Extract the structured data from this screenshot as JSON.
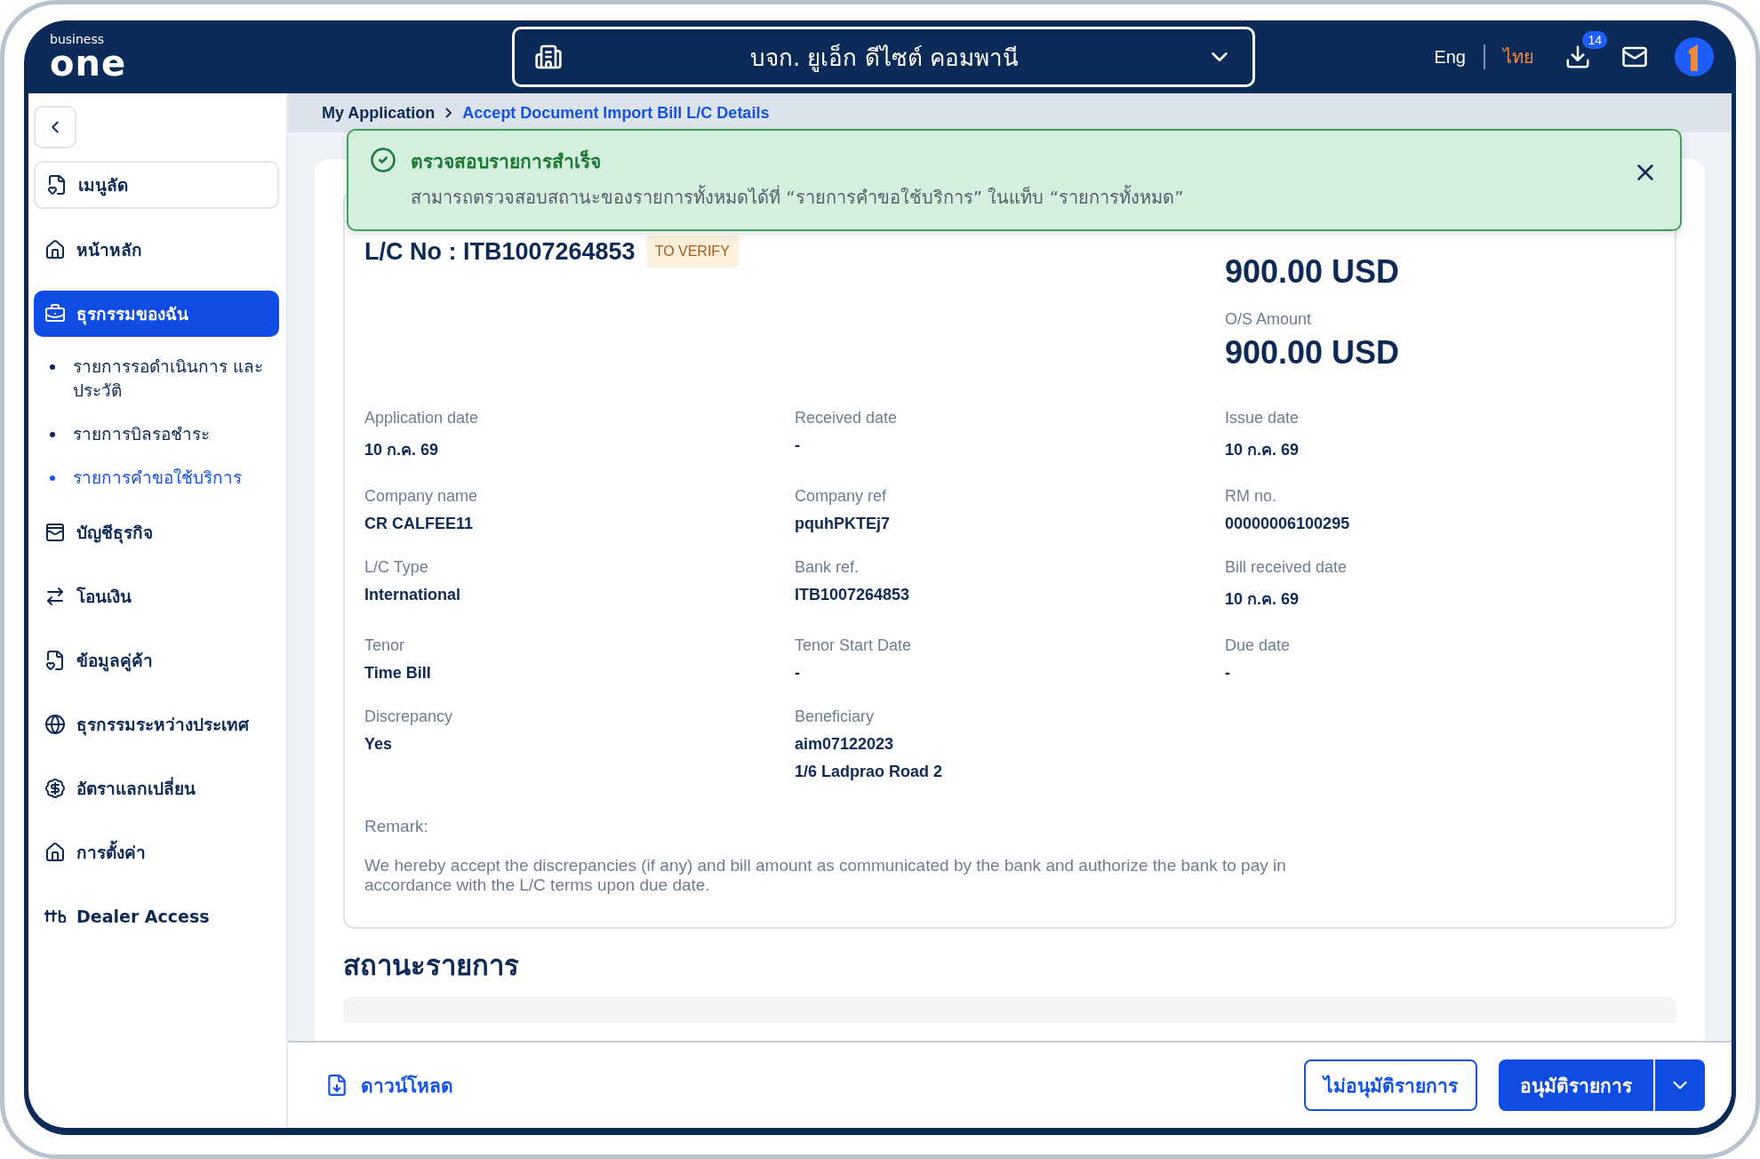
{
  "header": {
    "brand_small": "business",
    "brand": "one",
    "company": "บจก. ยูเอ็ก ดีไซต์ คอมพานี",
    "languages": [
      {
        "label": "Eng",
        "selected": false
      },
      {
        "label": "ไทย",
        "selected": true
      }
    ],
    "download_badge": "14"
  },
  "sidebar": {
    "items": [
      {
        "label": "เมนูลัด",
        "kind": "shortcut",
        "selected": false
      },
      {
        "label": "หน้าหลัก",
        "kind": "item",
        "selected": false
      },
      {
        "label": "ธุรกรรมของฉัน",
        "kind": "item",
        "selected": true,
        "children": [
          {
            "label": "รายการรอดำเนินการ และประวัติ",
            "selected": false
          },
          {
            "label": "รายการบิลรอชำระ",
            "selected": false
          },
          {
            "label": "รายการคำขอใช้บริการ",
            "selected": true
          }
        ]
      },
      {
        "label": "บัญชีธุรกิจ",
        "kind": "item",
        "selected": false
      },
      {
        "label": "โอนเงิน",
        "kind": "item",
        "selected": false
      },
      {
        "label": "ข้อมูลคู่ค้า",
        "kind": "item",
        "selected": false
      },
      {
        "label": "ธุรกรรมระหว่างประเทศ",
        "kind": "item",
        "selected": false
      },
      {
        "label": "อัตราแลกเปลี่ยน",
        "kind": "item",
        "selected": false
      },
      {
        "label": "การตั้งค่า",
        "kind": "item",
        "selected": false
      },
      {
        "label": "Dealer Access",
        "kind": "item",
        "selected": false
      }
    ]
  },
  "breadcrumb": [
    {
      "label": "My Application",
      "selected": false
    },
    {
      "label": "Accept Document Import Bill L/C Details",
      "selected": true
    }
  ],
  "toast": {
    "title": "ตรวจสอบรายการสำเร็จ",
    "message": "สามารถตรวจสอบสถานะของรายการทั้งหมดได้ที่ “รายการคำขอใช้บริการ” ในแท็บ “รายการทั้งหมด”"
  },
  "card": {
    "lc_no": "L/C No : ITB1007264853",
    "status": "TO VERIFY",
    "amounts": [
      {
        "value": "900.00 USD"
      },
      {
        "label": "O/S Amount",
        "value": "900.00 USD"
      }
    ],
    "fields": [
      {
        "label": "Application date",
        "values": [
          "10 ก.ค. 69"
        ]
      },
      {
        "label": "Received date",
        "values": [
          "-"
        ]
      },
      {
        "label": "Issue date",
        "values": [
          "10 ก.ค. 69"
        ]
      },
      {
        "label": "Company name",
        "values": [
          "CR CALFEE11"
        ]
      },
      {
        "label": "Company ref",
        "values": [
          "pquhPKTEj7"
        ]
      },
      {
        "label": "RM no.",
        "values": [
          "00000006100295"
        ]
      },
      {
        "label": "L/C Type",
        "values": [
          "International"
        ]
      },
      {
        "label": "Bank ref.",
        "values": [
          "ITB1007264853"
        ]
      },
      {
        "label": "Bill received date",
        "values": [
          "10 ก.ค. 69"
        ]
      },
      {
        "label": "Tenor",
        "values": [
          "Time Bill"
        ]
      },
      {
        "label": "Tenor Start Date",
        "values": [
          "-"
        ]
      },
      {
        "label": "Due date",
        "values": [
          "-"
        ]
      },
      {
        "label": "Discrepancy",
        "values": [
          "Yes"
        ]
      },
      {
        "label": "Beneficiary",
        "values": [
          "aim07122023",
          "1/6 Ladprao Road 2"
        ]
      }
    ],
    "remark_label": "Remark:",
    "remark": "We hereby accept the discrepancies (if any) and bill amount as communicated by the bank and authorize the bank to pay in accordance with the L/C terms upon due date."
  },
  "status_section": {
    "title": "สถานะรายการ"
  },
  "footer": {
    "download": "ดาวน์โหลด",
    "reject": "ไม่อนุมัติรายการ",
    "approve": "อนุมัติรายการ"
  }
}
